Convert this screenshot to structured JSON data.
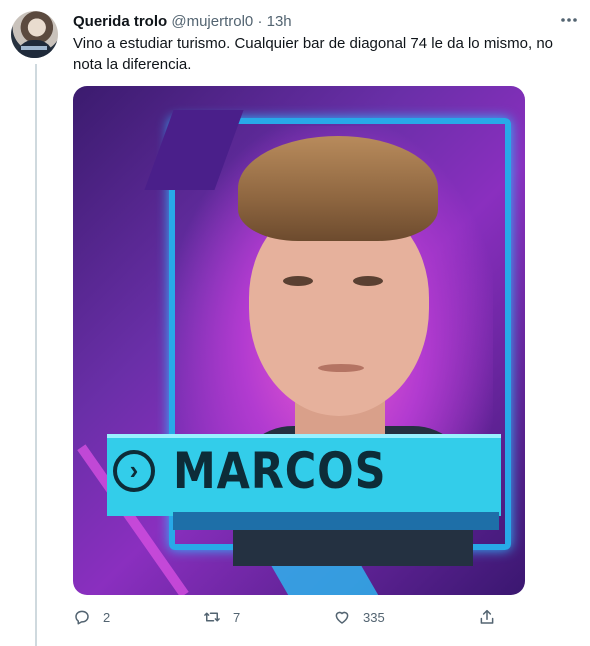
{
  "tweet": {
    "author_name": "Querida trolo",
    "handle": "@mujertrol0",
    "separator": "·",
    "time": "13h",
    "text": "Vino a estudiar turismo. Cualquier bar de diagonal 74 le da lo mismo, no nota la diferencia.",
    "more_icon": "more-icon"
  },
  "media": {
    "name_label": "MARCOS",
    "chevron_glyph": "›"
  },
  "actions": {
    "reply_count": "2",
    "retweet_count": "7",
    "like_count": "335"
  },
  "colors": {
    "text_primary": "#0f1419",
    "text_secondary": "#536471",
    "frame_blue": "#28a9e8",
    "banner_cyan": "#33cdea"
  }
}
